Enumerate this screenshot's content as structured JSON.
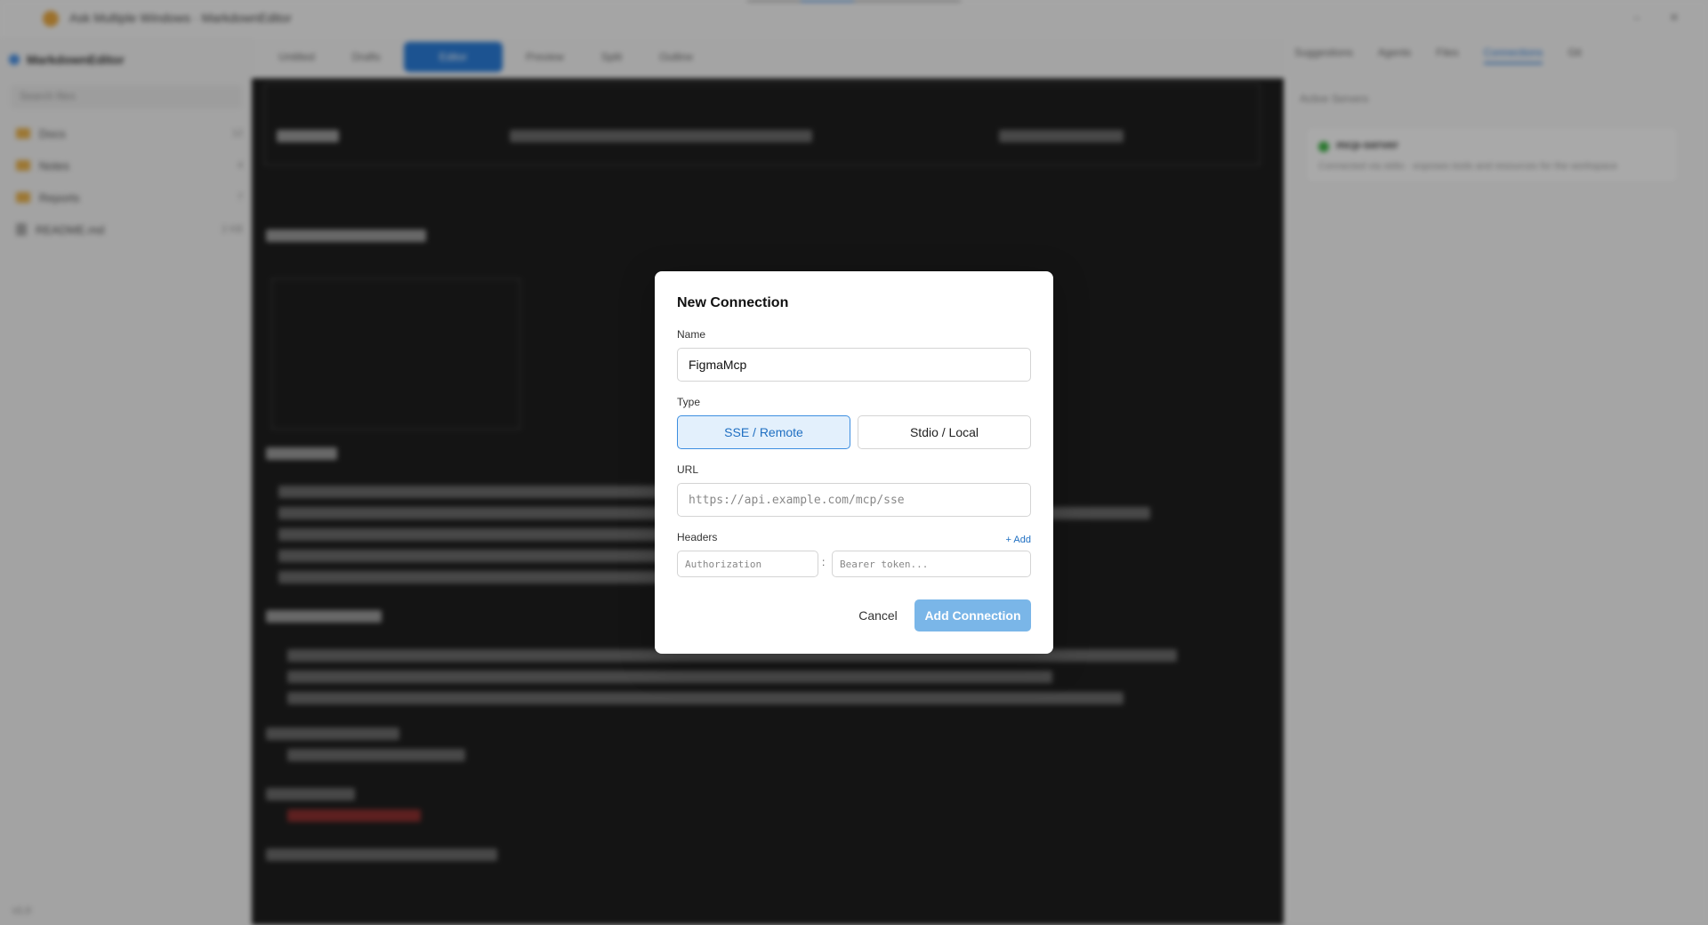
{
  "app": {
    "title": "Ask Multiple Windows  ·  MarkdownEditor",
    "project_name": "MarkdownEditor",
    "search_placeholder": "Search files",
    "footer": "v1.0"
  },
  "left_tree": [
    {
      "label": "Docs",
      "count": "12"
    },
    {
      "label": "Notes",
      "count": "4"
    },
    {
      "label": "Reports",
      "count": "7"
    },
    {
      "label": "README.md",
      "count": "2 KB"
    }
  ],
  "editor_tabs": [
    "Untitled",
    "Drafts",
    "Editor",
    "Preview",
    "Split",
    "Outline"
  ],
  "right_tabs": [
    "Suggestions",
    "Agents",
    "Files",
    "Connections",
    "Git"
  ],
  "right_panel": {
    "head": "Active Servers",
    "card_name": "mcp-server",
    "card_desc": "Connected via stdio · exposes tools and resources for the workspace"
  },
  "modal": {
    "title": "New Connection",
    "name_label": "Name",
    "name_value": "FigmaMcp",
    "type_label": "Type",
    "type_options": [
      "SSE / Remote",
      "Stdio / Local"
    ],
    "type_selected": "SSE / Remote",
    "url_label": "URL",
    "url_placeholder": "https://api.example.com/mcp/sse",
    "headers_label": "Headers",
    "add_link": "+ Add",
    "header_key_placeholder": "Authorization",
    "header_separator": ":",
    "header_value_placeholder": "Bearer token...",
    "cancel_label": "Cancel",
    "submit_label": "Add Connection"
  },
  "colors": {
    "accent": "#1f6fc2",
    "selected_bg": "#e3f0fc",
    "submit_disabled": "#7ab6e8",
    "editor_bg": "#1e1e1e"
  }
}
